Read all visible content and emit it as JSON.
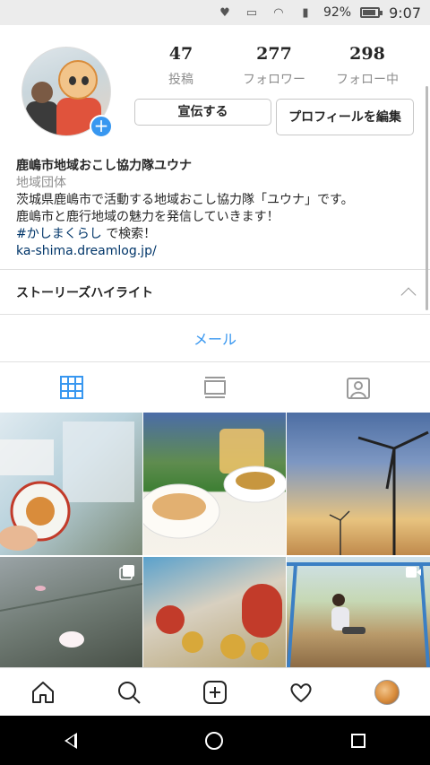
{
  "status_bar": {
    "battery": "92%",
    "time": "9:07"
  },
  "profile": {
    "stats": [
      {
        "value": "47",
        "label": "投稿"
      },
      {
        "value": "277",
        "label": "フォロワー"
      },
      {
        "value": "298",
        "label": "フォロー中"
      }
    ],
    "promote_label": "宣伝する",
    "edit_label": "プロフィールを編集",
    "bio": {
      "name": "鹿嶋市地域おこし協力隊ユウナ",
      "category": "地域団体",
      "line1": "茨城県鹿嶋市で活動する地域おこし協力隊「ユウナ」です。",
      "line2": "鹿嶋市と鹿行地域の魅力を発信していきます！",
      "hashtag": "#かしまくらし",
      "hashtag_suffix": "で検索！",
      "link": "ka-shima.dreamlog.jp/"
    }
  },
  "highlights": {
    "title": "ストーリーズハイライト"
  },
  "contact": {
    "mail_label": "メール"
  },
  "tabs": [
    {
      "icon": "grid-icon",
      "active": true
    },
    {
      "icon": "feed-list-icon",
      "active": false
    },
    {
      "icon": "tagged-photos-icon",
      "active": false
    }
  ],
  "grid_badges": [
    {
      "tile": 4,
      "icon": "carousel-icon"
    },
    {
      "tile": 6,
      "icon": "video-icon"
    }
  ],
  "bottom_nav": [
    "home-icon",
    "search-icon",
    "new-post-icon",
    "activity-heart-icon",
    "profile-avatar"
  ],
  "colors": {
    "accent": "#3897f0",
    "link": "#003569",
    "muted": "#8e8e8e",
    "text": "#262626"
  }
}
